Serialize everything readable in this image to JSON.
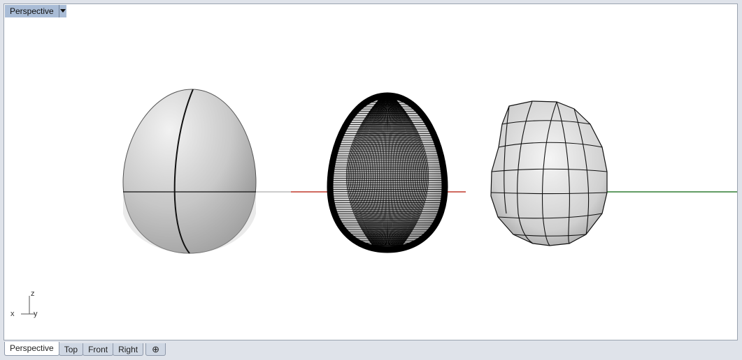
{
  "viewport": {
    "title": "Perspective",
    "dropdown_icon": "triangle-down-icon",
    "axis_labels": {
      "x": "x",
      "y": "y",
      "z": "z"
    },
    "objects": [
      {
        "name": "nurbs-egg",
        "display": "shaded with isocurves"
      },
      {
        "name": "dense-mesh-egg",
        "display": "dense wireframe mesh"
      },
      {
        "name": "low-poly-mesh-egg",
        "display": "low polygon mesh"
      }
    ],
    "colors": {
      "background": "#ffffff",
      "x_axis": "#c0392b",
      "y_axis": "#2e7d32",
      "title_bg": "#a9bcd6"
    }
  },
  "tabs": [
    {
      "label": "Perspective",
      "active": true
    },
    {
      "label": "Top",
      "active": false
    },
    {
      "label": "Front",
      "active": false
    },
    {
      "label": "Right",
      "active": false
    }
  ],
  "add_tab": {
    "icon": "plus-icon",
    "label": "⊕"
  }
}
